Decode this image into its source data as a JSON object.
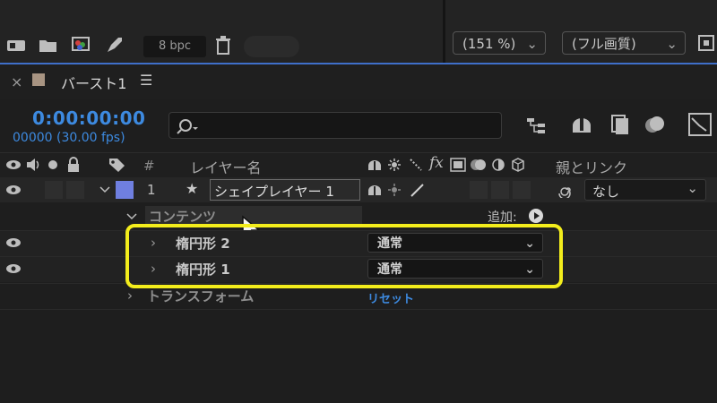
{
  "toolbar": {
    "bpc": "8 bpc",
    "zoom": "(151 %)",
    "resolution": "(フル画質)"
  },
  "tab": {
    "close": "×",
    "title": "バースト1",
    "menu": "☰"
  },
  "timeline": {
    "timecode": "0:00:00:00",
    "frames": "00000 (30.00 fps)",
    "search_placeholder": ""
  },
  "columns": {
    "number": "#",
    "layer_name": "レイヤー名",
    "fx": "fx",
    "parent": "親とリンク"
  },
  "layer": {
    "number": "1",
    "star": "★",
    "name": "シェイプレイヤー 1",
    "parent_value": "なし",
    "label_color": "#6f7fe0"
  },
  "contents": {
    "label": "コンテンツ",
    "add": "追加:",
    "items": [
      {
        "name": "楕円形 2",
        "blend": "通常"
      },
      {
        "name": "楕円形 1",
        "blend": "通常"
      }
    ]
  },
  "transform": {
    "label": "トランスフォーム",
    "reset": "リセット"
  },
  "highlight_color": "#f3ed1c"
}
